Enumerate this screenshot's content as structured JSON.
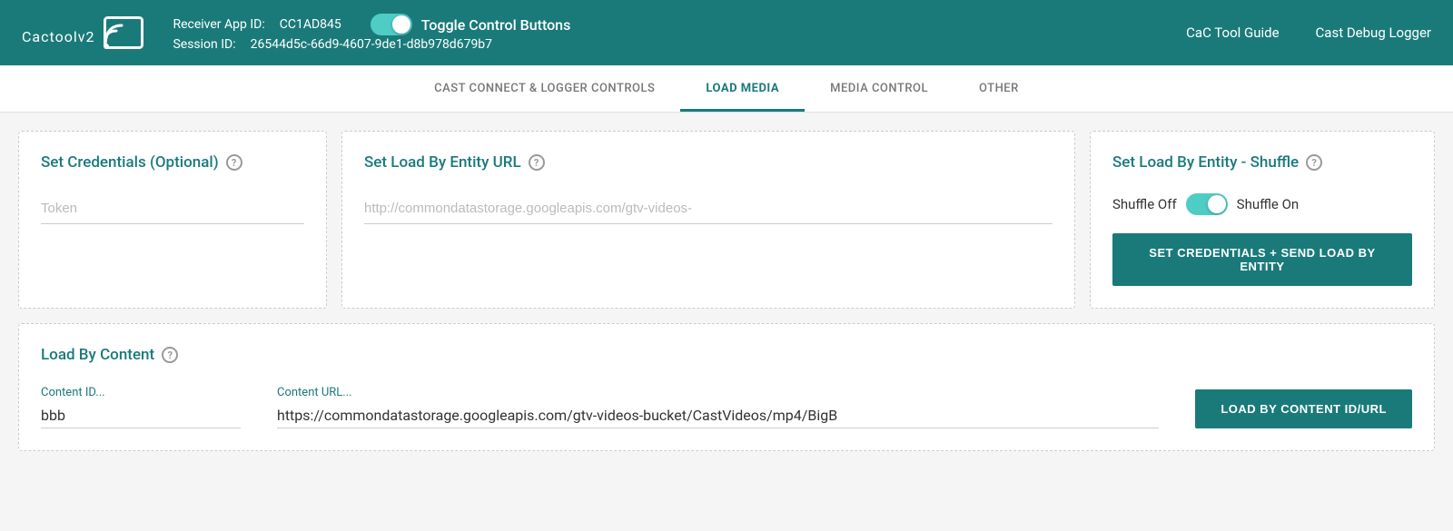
{
  "header": {
    "logo_text": "Cactool",
    "logo_version": "v2",
    "receiver_app_label": "Receiver App ID:",
    "receiver_app_id": "CC1AD845",
    "session_label": "Session ID:",
    "session_id": "26544d5c-66d9-4607-9de1-d8b978d679b7",
    "toggle_label": "Toggle Control Buttons",
    "nav_links": [
      {
        "label": "CaC Tool Guide"
      },
      {
        "label": "Cast Debug Logger"
      }
    ]
  },
  "tabs": [
    {
      "label": "CAST CONNECT & LOGGER CONTROLS",
      "active": false
    },
    {
      "label": "LOAD MEDIA",
      "active": true
    },
    {
      "label": "MEDIA CONTROL",
      "active": false
    },
    {
      "label": "OTHER",
      "active": false
    }
  ],
  "load_media": {
    "credentials_card": {
      "title": "Set Credentials (Optional)",
      "token_placeholder": "Token"
    },
    "entity_url_card": {
      "title": "Set Load By Entity URL",
      "url_placeholder": "http://commondatastorage.googleapis.com/gtv-videos-"
    },
    "shuffle_card": {
      "title": "Set Load By Entity - Shuffle",
      "shuffle_off_label": "Shuffle Off",
      "shuffle_on_label": "Shuffle On",
      "button_label": "SET CREDENTIALS + SEND LOAD BY ENTITY"
    },
    "load_content_card": {
      "title": "Load By Content",
      "content_id_label": "Content ID...",
      "content_id_value": "bbb",
      "content_url_label": "Content URL...",
      "content_url_value": "https://commondatastorage.googleapis.com/gtv-videos-bucket/CastVideos/mp4/BigB",
      "button_label": "LOAD BY CONTENT ID/URL"
    }
  },
  "colors": {
    "teal": "#1a7a7a",
    "toggle": "#4ecdc4"
  }
}
